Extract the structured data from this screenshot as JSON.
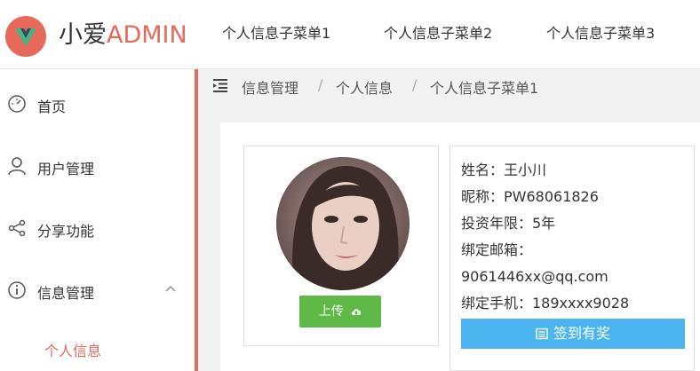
{
  "header": {
    "brand_prefix": "小爱",
    "brand_accent": "ADMIN",
    "nav": [
      "个人信息子菜单1",
      "个人信息子菜单2",
      "个人信息子菜单3"
    ]
  },
  "sidebar": {
    "items": [
      {
        "label": "首页",
        "icon": "dashboard-icon"
      },
      {
        "label": "用户管理",
        "icon": "user-icon"
      },
      {
        "label": "分享功能",
        "icon": "share-icon"
      },
      {
        "label": "信息管理",
        "icon": "info-icon"
      }
    ],
    "active_sub": "个人信息"
  },
  "breadcrumb": [
    "信息管理",
    "个人信息",
    "个人信息子菜单1"
  ],
  "profile": {
    "upload_label": "上传",
    "name": "姓名：王小川",
    "nickname": "昵称：PW68061826",
    "invest_years": "投资年限：5年",
    "email_label": "绑定邮箱：",
    "email": "9061446xx@qq.com",
    "phone": "绑定手机：189xxxx9028",
    "checkin_label": "签到有奖"
  },
  "colors": {
    "accent": "#e6695a",
    "upload_green": "#5fb947",
    "checkin_blue": "#4ab5f0"
  }
}
